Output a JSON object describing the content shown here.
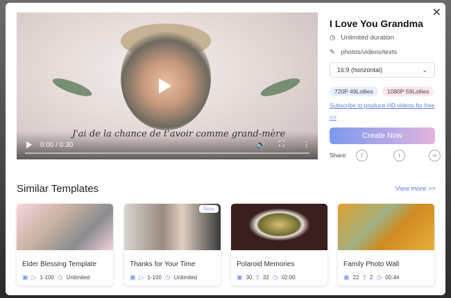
{
  "video": {
    "caption": "J'ai de la chance de t'avoir comme grand-mère",
    "time": "0:00 / 0:30"
  },
  "details": {
    "title": "I Love You Grandma",
    "duration": "Unlimited duration",
    "materials": "photos/videos/texts",
    "aspect": "16:9 (horizontal)",
    "price_720": "720P 49Lollies",
    "price_1080": "1080P 59Lollies",
    "subscribe": "Subscribe to produce HD videos for free >>",
    "create": "Create Now",
    "share": "Share:"
  },
  "similar": {
    "title": "Similar Templates",
    "view_more": "View more >>",
    "new_badge": "New",
    "cards": [
      {
        "name": "Elder Blessing Template",
        "m1": "1-100",
        "m2": "Unlimited"
      },
      {
        "name": "Thanks for Your Time",
        "m1": "1-100",
        "m2": "Unlimited"
      },
      {
        "name": "Polaroid Memories",
        "m1": "30",
        "t": "32",
        "m2": "02:00"
      },
      {
        "name": "Family Photo Wall",
        "m1": "22",
        "t": "2",
        "m2": "00:44"
      }
    ]
  },
  "colors": {
    "accent": "#5b7fe0",
    "button_from": "#7d99ef",
    "button_to": "#e2b3de"
  }
}
